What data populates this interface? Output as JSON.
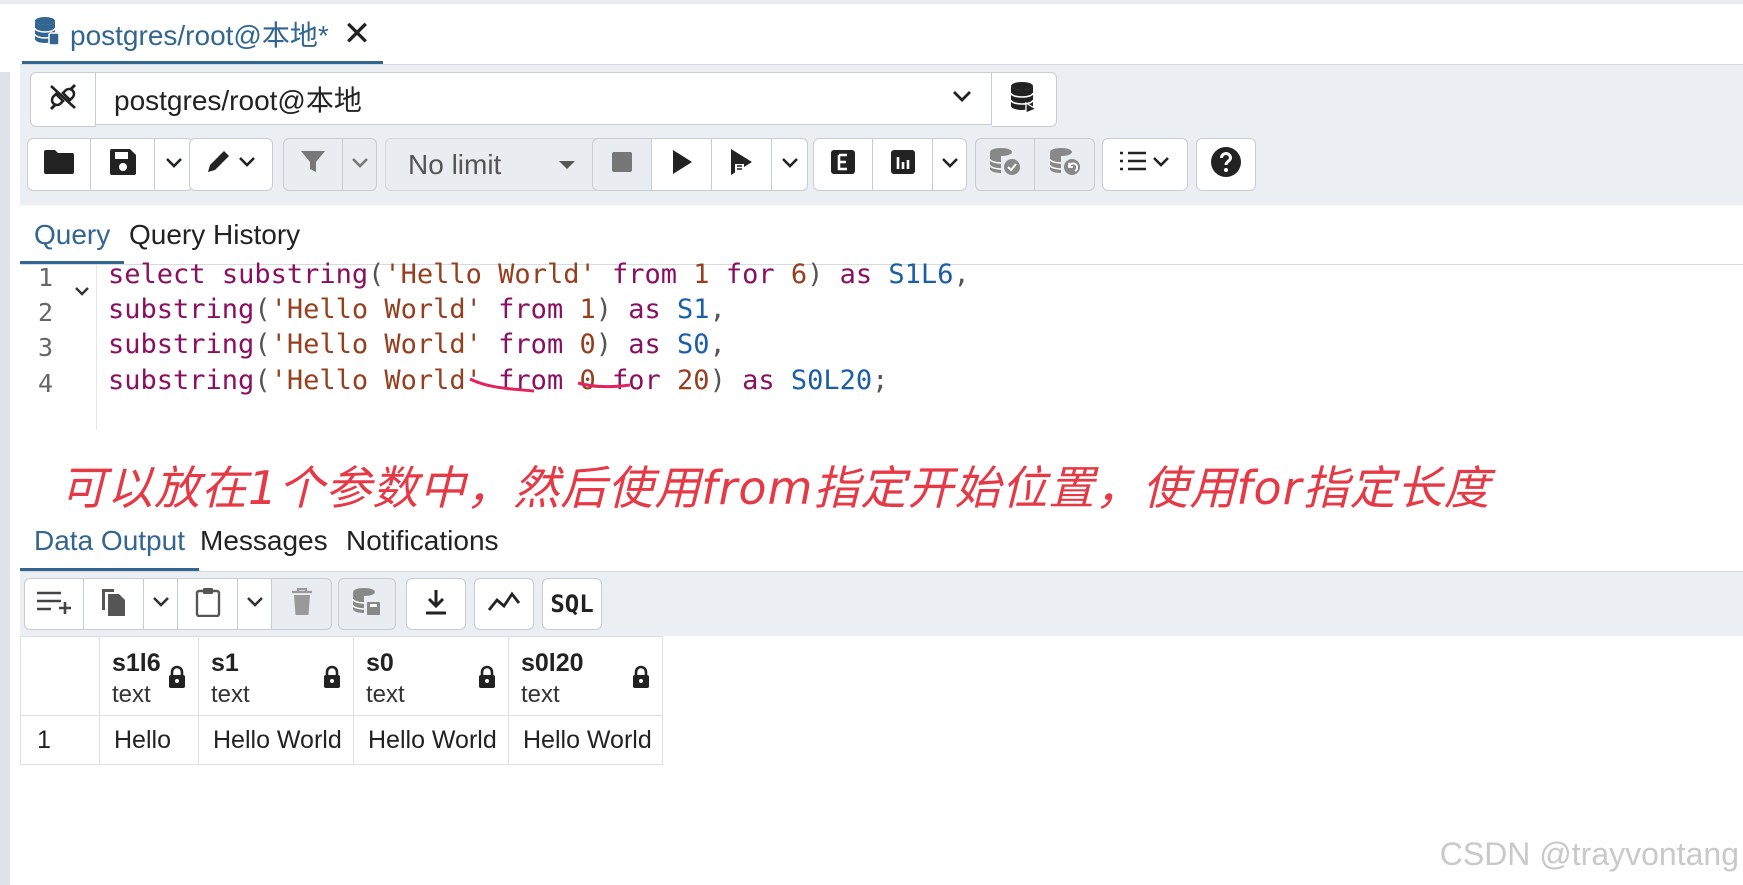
{
  "window": {
    "tab_title": "postgres/root@本地*"
  },
  "connection": {
    "selected": "postgres/root@本地"
  },
  "toolbar": {
    "limit_label": "No limit"
  },
  "query_tabs": [
    "Query",
    "Query History"
  ],
  "editor": {
    "line_numbers": [
      "1",
      "2",
      "3",
      "4"
    ],
    "lines": [
      "select substring('Hello World' from 1 for 6) as S1L6,",
      "substring('Hello World' from 1) as S1,",
      "substring('Hello World' from 0) as S0,",
      "substring('Hello World' from 0 for 20) as S0L20;"
    ],
    "annotation": "可以放在1个参数中，然后使用from指定开始位置，使用for指定长度"
  },
  "output_tabs": [
    "Data Output",
    "Messages",
    "Notifications"
  ],
  "output_toolbar": {
    "sql_label": "SQL"
  },
  "grid": {
    "columns": [
      {
        "name": "s1l6",
        "type": "text"
      },
      {
        "name": "s1",
        "type": "text"
      },
      {
        "name": "s0",
        "type": "text"
      },
      {
        "name": "s0l20",
        "type": "text"
      }
    ],
    "rows": [
      {
        "num": "1",
        "cells": [
          "Hello",
          "Hello World",
          "Hello World",
          "Hello World"
        ]
      }
    ]
  },
  "watermark": "CSDN @trayvontang",
  "colors": {
    "accent": "#326690",
    "annotation": "#e63946",
    "keyword": "#8a0f61",
    "string": "#963f1f",
    "identifier": "#1b5ea8"
  }
}
